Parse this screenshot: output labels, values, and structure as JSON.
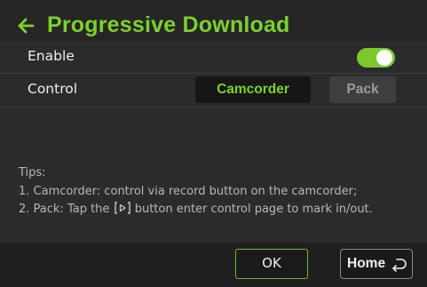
{
  "header": {
    "title": "Progressive Download",
    "back_icon": "back-arrow-icon",
    "accent": "#7cd12e"
  },
  "settings": {
    "enable": {
      "label": "Enable",
      "toggle_on": true,
      "toggle_color": "#7cc82c"
    },
    "control": {
      "label": "Control",
      "options": [
        "Camcorder",
        "Pack"
      ],
      "selected": "Camcorder"
    }
  },
  "tips": {
    "heading": "Tips:",
    "line1": "1. Camcorder: control via record button on the camcorder;",
    "line2_before": "2. Pack: Tap the",
    "line2_icon": "play-button-icon",
    "line2_after": "button enter control page to mark in/out."
  },
  "footer": {
    "ok_label": "OK",
    "home_label": "Home",
    "home_icon": "return-arrow-icon"
  }
}
